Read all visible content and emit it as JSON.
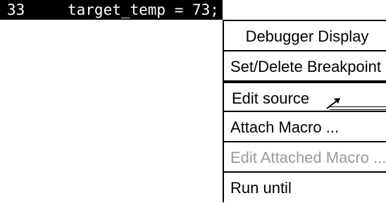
{
  "code": {
    "line_number": "33",
    "text": "target_temp = 73;"
  },
  "menu": {
    "title": "Debugger Display",
    "items": [
      {
        "label": "Set/Delete Breakpoint",
        "state": "normal"
      },
      {
        "label": "Edit source",
        "state": "highlighted"
      },
      {
        "label": "Attach Macro ...",
        "state": "normal"
      },
      {
        "label": "Edit Attached Macro ...",
        "state": "disabled"
      },
      {
        "label": "Run until",
        "state": "normal"
      }
    ]
  },
  "icons": {
    "pointer": "mouse-pointer-icon"
  }
}
